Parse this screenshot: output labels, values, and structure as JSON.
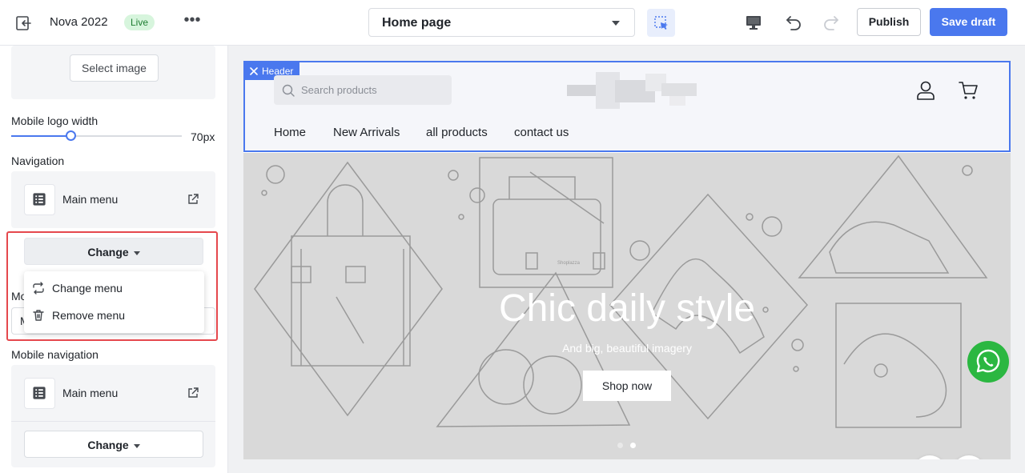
{
  "topbar": {
    "title": "Nova 2022",
    "live_badge": "Live",
    "page_selector": "Home page",
    "publish_label": "Publish",
    "save_draft_label": "Save draft"
  },
  "panel": {
    "select_image_label": "Select image",
    "mobile_logo_width": {
      "label": "Mobile logo width",
      "value": "70px",
      "level": 0.35
    },
    "navigation": {
      "label": "Navigation",
      "menu_name": "Main menu",
      "change_label": "Change"
    },
    "dropdown": {
      "items": [
        "Change menu",
        "Remove menu"
      ]
    },
    "obscured_label_fragment": "Mo",
    "obscured_field_fragment": "M",
    "mobile_navigation": {
      "label": "Mobile navigation",
      "menu_name": "Main menu",
      "change_label": "Change"
    }
  },
  "preview": {
    "header_tag": "Header",
    "search_placeholder": "Search products",
    "nav_links": [
      "Home",
      "New Arrivals",
      "all products",
      "contact us"
    ],
    "hero": {
      "title": "Chic daily style",
      "subtitle": "And big, beautiful imagery",
      "button": "Shop now",
      "bag_brand": "Shoplazza",
      "active_slide": 2,
      "slide_count": 2
    }
  },
  "colors": {
    "accent": "#4a78ee",
    "live_bg": "#d7f5dd",
    "highlight": "#e5484d",
    "whatsapp": "#2bb741"
  },
  "icons": [
    "exit-icon",
    "more-icon",
    "select-element-icon",
    "desktop-icon",
    "undo-icon",
    "redo-icon",
    "list-icon",
    "external-link-icon",
    "swap-icon",
    "trash-icon",
    "search-icon",
    "close-icon",
    "user-icon",
    "cart-icon",
    "whatsapp-icon",
    "chevron-left-icon",
    "chevron-right-icon"
  ]
}
